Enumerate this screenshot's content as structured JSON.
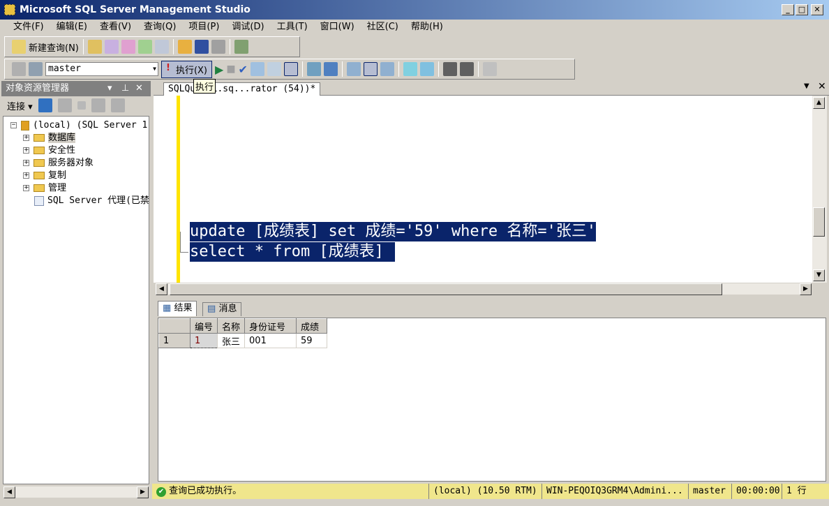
{
  "window": {
    "title": "Microsoft SQL Server Management Studio",
    "min": "_",
    "max": "□",
    "close": "✕"
  },
  "menu": [
    "文件(F)",
    "编辑(E)",
    "查看(V)",
    "查询(Q)",
    "项目(P)",
    "调试(D)",
    "工具(T)",
    "窗口(W)",
    "社区(C)",
    "帮助(H)"
  ],
  "toolbar1": {
    "new_query": "新建查询(N)"
  },
  "toolbar2": {
    "database": "master",
    "execute": "执行(X)",
    "tooltip": "执行"
  },
  "object_explorer": {
    "title": "对象资源管理器",
    "connect": "连接",
    "server": "(local) (SQL Server 1",
    "items": [
      "数据库",
      "安全性",
      "服务器对象",
      "复制",
      "管理"
    ],
    "agent": "SQL Server 代理(已禁"
  },
  "editor": {
    "tab": "SQLQu...1.sq...rator (54))*",
    "lines": [
      "update [成绩表] set 成绩='59' where 名称='张三'",
      "select * from [成绩表]"
    ]
  },
  "results": {
    "tabs": [
      "结果",
      "消息"
    ],
    "columns": [
      "编号",
      "名称",
      "身份证号",
      "成绩"
    ],
    "rows": [
      {
        "num": "1",
        "cells": [
          "1",
          "张三",
          "001",
          "59"
        ]
      }
    ]
  },
  "status": {
    "message": "查询已成功执行。",
    "server": "(local) (10.50 RTM)",
    "user": "WIN-PEQOIQ3GRM4\\Admini...",
    "db": "master",
    "time": "00:00:00",
    "rows": "1 行"
  }
}
